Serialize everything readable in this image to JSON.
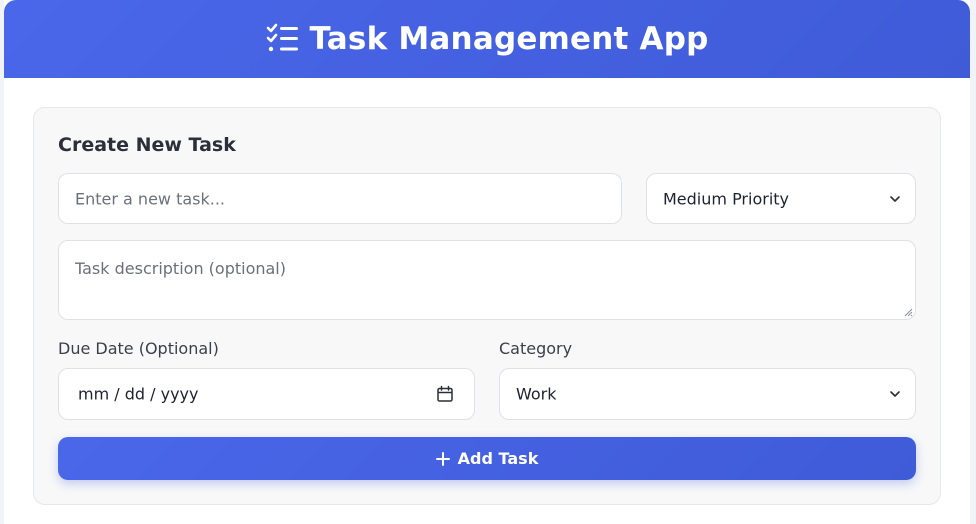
{
  "header": {
    "title": "Task Management App",
    "icon": "tasks-icon"
  },
  "form": {
    "title": "Create New Task",
    "task_input": {
      "placeholder": "Enter a new task...",
      "value": ""
    },
    "priority": {
      "selected": "Medium Priority"
    },
    "description": {
      "placeholder": "Task description (optional)",
      "value": ""
    },
    "due_date": {
      "label": "Due Date (Optional)",
      "value": "mm / dd / yyyy"
    },
    "category": {
      "label": "Category",
      "selected": "Work"
    },
    "add_button": {
      "label": "Add Task",
      "icon": "plus-icon"
    }
  },
  "colors": {
    "accent": "#4a67ea",
    "accent_dark": "#3f5bd8",
    "card_bg": "#f8f8f9",
    "text": "#2b2f3a"
  }
}
